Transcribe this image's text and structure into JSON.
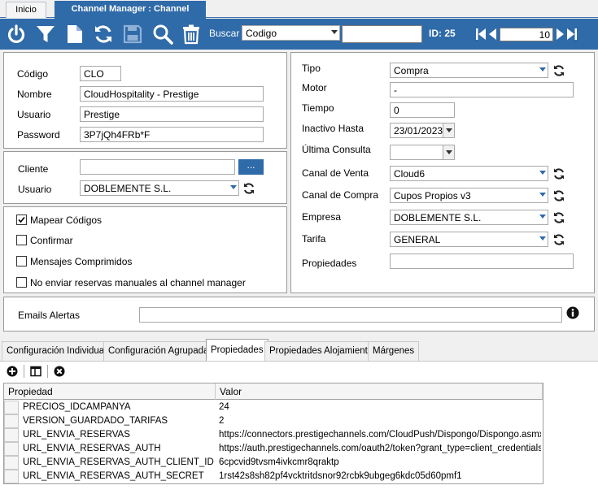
{
  "tabs": [
    {
      "label": "Inicio"
    },
    {
      "label": "Channel Manager : Channel"
    }
  ],
  "toolbar": {
    "buscar_label": "Buscar",
    "search_select": "Codigo",
    "search_value": "",
    "id_label": "ID: 25",
    "record_number": "10",
    "icons": [
      "power-icon",
      "filter-icon",
      "new-document-icon",
      "refresh-icon",
      "save-icon",
      "search-icon",
      "trash-icon"
    ]
  },
  "general": {
    "codigo_label": "Código",
    "codigo_value": "CLO",
    "nombre_label": "Nombre",
    "nombre_value": "CloudHospitality - Prestige",
    "usuario_label": "Usuario",
    "usuario_value": "Prestige",
    "password_label": "Password",
    "password_value": "3P7jQh4FRb*F"
  },
  "cliente": {
    "cliente_label": "Cliente",
    "cliente_value": "",
    "ellipsis": "...",
    "usuario_label": "Usuario",
    "usuario_value": "DOBLEMENTE S.L."
  },
  "options": [
    {
      "label": "Mapear Códigos",
      "checked": true
    },
    {
      "label": "Confirmar",
      "checked": false
    },
    {
      "label": "Mensajes Comprimidos",
      "checked": false
    },
    {
      "label": "No enviar reservas manuales al channel manager",
      "checked": false
    }
  ],
  "right": {
    "tipo_label": "Tipo",
    "tipo_value": "Compra",
    "motor_label": "Motor",
    "motor_value": "-",
    "tiempo_label": "Tiempo",
    "tiempo_value": "0",
    "inactivo_label": "Inactivo Hasta",
    "inactivo_value": "23/01/2023",
    "ultima_label": "Última Consulta",
    "ultima_value": "",
    "canal_venta_label": "Canal de Venta",
    "canal_venta_value": "Cloud6",
    "canal_compra_label": "Canal de Compra",
    "canal_compra_value": "Cupos Propios v3",
    "empresa_label": "Empresa",
    "empresa_value": "DOBLEMENTE S.L.",
    "tarifa_label": "Tarifa",
    "tarifa_value": "GENERAL",
    "propiedades_label": "Propiedades",
    "propiedades_value": ""
  },
  "emails": {
    "label": "Emails Alertas",
    "value": ""
  },
  "subtabs": [
    {
      "label": "Configuración Individual"
    },
    {
      "label": "Configuración Agrupada"
    },
    {
      "label": "Propiedades"
    },
    {
      "label": "Propiedades Alojamiento"
    },
    {
      "label": "Márgenes"
    }
  ],
  "grid": {
    "columns": [
      "Propiedad",
      "Valor"
    ],
    "rows": [
      {
        "propiedad": "PRECIOS_IDCAMPANYA",
        "valor": "24"
      },
      {
        "propiedad": "VERSION_GUARDADO_TARIFAS",
        "valor": "2"
      },
      {
        "propiedad": "URL_ENVIA_RESERVAS",
        "valor": "https://connectors.prestigechannels.com/CloudPush/Dispongo/Dispongo.asmx"
      },
      {
        "propiedad": "URL_ENVIA_RESERVAS_AUTH",
        "valor": "https://auth.prestigechannels.com/oauth2/token?grant_type=client_credentials"
      },
      {
        "propiedad": "URL_ENVIA_RESERVAS_AUTH_CLIENT_ID",
        "valor": "6cpcvid9tvsm4ivkcmr8qraktp"
      },
      {
        "propiedad": "URL_ENVIA_RESERVAS_AUTH_SECRET",
        "valor": "1rst42s8sh82pf4vcktritdsnor92rcbk9ubgeg6kdc05d60pmf1"
      }
    ]
  },
  "colors": {
    "accent": "#2f6aa9"
  }
}
